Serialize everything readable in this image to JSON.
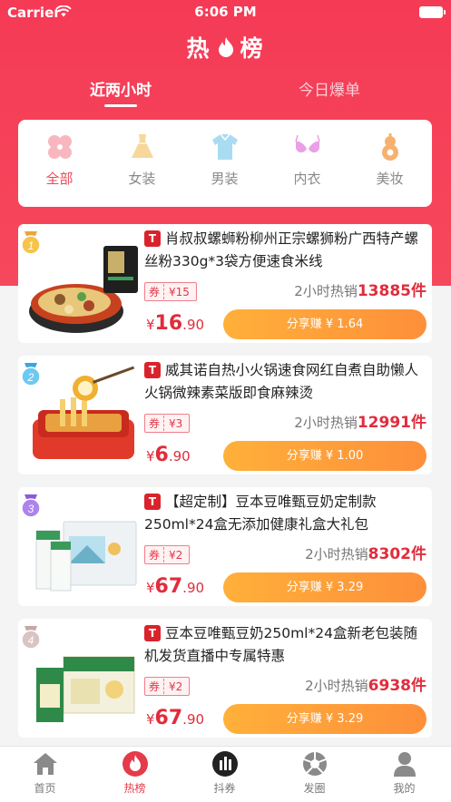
{
  "status_bar": {
    "carrier": "Carrier",
    "time": "6:06 PM"
  },
  "header": {
    "title_left": "热",
    "title_right": "榜"
  },
  "tabs": [
    {
      "label": "近两小时",
      "active": true
    },
    {
      "label": "今日爆单",
      "active": false
    }
  ],
  "categories": [
    {
      "label": "全部",
      "icon": "all-icon",
      "active": true
    },
    {
      "label": "女装",
      "icon": "dress-icon"
    },
    {
      "label": "男装",
      "icon": "shirt-icon"
    },
    {
      "label": "内衣",
      "icon": "bra-icon"
    },
    {
      "label": "美妆",
      "icon": "gourd-icon"
    }
  ],
  "products": [
    {
      "rank": "1",
      "shop_badge": "T",
      "title": "肖叔叔螺蛳粉柳州正宗螺狮粉广西特产螺丝粉330g*3袋方便速食米线",
      "coupon_key": "券",
      "coupon_value": "¥15",
      "sales_prefix": "2小时热销",
      "sales_count": "13885件",
      "price_currency": "¥",
      "price_int": "16",
      "price_dec": ".90",
      "share_label": "分享赚 ¥ 1.64"
    },
    {
      "rank": "2",
      "shop_badge": "T",
      "title": "威其诺自热小火锅速食网红自煮自助懒人火锅微辣素菜版即食麻辣烫",
      "coupon_key": "券",
      "coupon_value": "¥3",
      "sales_prefix": "2小时热销",
      "sales_count": "12991件",
      "price_currency": "¥",
      "price_int": "6",
      "price_dec": ".90",
      "share_label": "分享赚 ¥ 1.00"
    },
    {
      "rank": "3",
      "shop_badge": "T",
      "title": "【超定制】豆本豆唯甄豆奶定制款250ml*24盒无添加健康礼盒大礼包",
      "coupon_key": "券",
      "coupon_value": "¥2",
      "sales_prefix": "2小时热销",
      "sales_count": "8302件",
      "price_currency": "¥",
      "price_int": "67",
      "price_dec": ".90",
      "share_label": "分享赚 ¥ 3.29"
    },
    {
      "rank": "4",
      "shop_badge": "T",
      "title": "豆本豆唯甄豆奶250ml*24盒新老包装随机发货直播中专属特惠",
      "coupon_key": "券",
      "coupon_value": "¥2",
      "sales_prefix": "2小时热销",
      "sales_count": "6938件",
      "price_currency": "¥",
      "price_int": "67",
      "price_dec": ".90",
      "share_label": "分享赚 ¥ 3.29"
    }
  ],
  "bottom_nav": [
    {
      "label": "首页",
      "icon": "home-icon"
    },
    {
      "label": "热榜",
      "icon": "flame-icon",
      "active": true
    },
    {
      "label": "抖券",
      "icon": "bars-icon"
    },
    {
      "label": "发圈",
      "icon": "aperture-icon"
    },
    {
      "label": "我的",
      "icon": "user-icon"
    }
  ],
  "colors": {
    "brand_red": "#f53a56",
    "price_red": "#e12c3c",
    "share_orange": "#fe8f3a",
    "tmall_red": "#d9232b"
  }
}
